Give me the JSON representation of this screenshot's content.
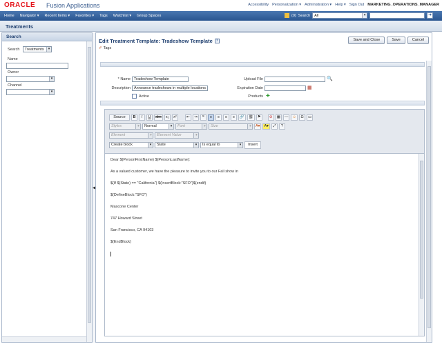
{
  "header": {
    "logo": "ORACLE",
    "product": "Fusion Applications",
    "links": [
      "Accessibility",
      "Personalization ▾",
      "Administration ▾",
      "Help ▾",
      "Sign Out"
    ],
    "user": "MARKETING_OPERATIONS_MANAGER"
  },
  "nav": {
    "items": [
      "Home",
      "Navigator ▾",
      "Recent Items ▾",
      "Favorites ▾",
      "Tags",
      "Watchlist ▾",
      "Group Spaces"
    ],
    "fav_count": "(0)",
    "search_label": "Search",
    "search_scope": "All"
  },
  "page": {
    "title": "Treatments"
  },
  "search_panel": {
    "title": "Search",
    "search_label": "Search",
    "search_value": "Treatments",
    "name_label": "Name",
    "owner_label": "Owner",
    "channel_label": "Channel"
  },
  "main": {
    "title": "Edit Treatment Template: Tradeshow Template",
    "tags_label": "Tags",
    "buttons": {
      "save_close": "Save and Close",
      "save": "Save",
      "cancel": "Cancel"
    },
    "form": {
      "name_label": "* Name",
      "name_value": "Tradeshow Template",
      "description_label": "Description",
      "description_value": "Announce tradeshows in multiple locations",
      "active_label": "Active",
      "upload_label": "Upload File",
      "expiration_label": "Expiration Date",
      "products_label": "Products"
    }
  },
  "editor": {
    "source_label": "Source",
    "styles": "Styles",
    "format": "Normal",
    "font": "Font",
    "size": "Size",
    "element": "Element",
    "element_value": "Element Value",
    "create_block": "Create block",
    "state": "State",
    "operator": "Is equal to",
    "insert": "Insert",
    "lines": [
      "Dear $(PersonFirstName) $(PersonLastName):",
      "As a valued customer, we have the pleasure to invite you to our Fall show in",
      "$(If $(State) == \"California\") $(InsertBlock:\"SFO\")$(endif)",
      "$(DefineBlock:\"SFO\")",
      "Mascone Center",
      "747 Howard Street",
      "San Francisco, CA 94103",
      "$(EndBlock)"
    ]
  }
}
